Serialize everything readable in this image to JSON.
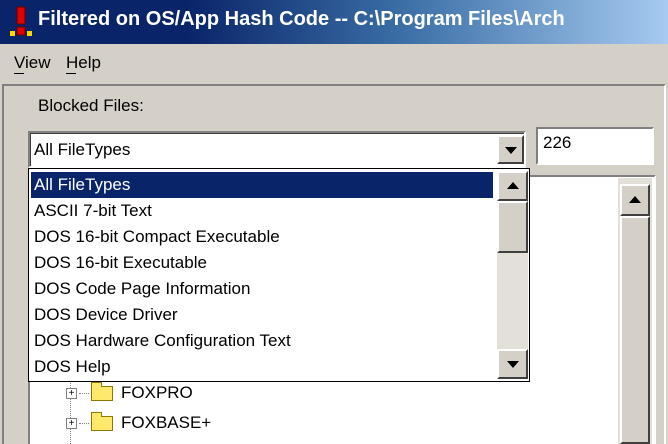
{
  "window": {
    "title": "Filtered on OS/App Hash Code -- C:\\Program Files\\Arch",
    "icon": "exclamation-app-icon"
  },
  "menu": {
    "view": "View",
    "help": "Help"
  },
  "blocked_files": {
    "label": "Blocked Files:",
    "filter_value": "All FileTypes",
    "count": "226"
  },
  "dropdown": {
    "items": [
      "All FileTypes",
      "ASCII 7-bit Text",
      "DOS 16-bit Compact Executable",
      "DOS 16-bit Executable",
      "DOS Code Page Information",
      "DOS Device Driver",
      "DOS Hardware Configuration Text",
      "DOS Help"
    ],
    "selected_index": 0
  },
  "tree": {
    "nodes": [
      "FOXPRO",
      "FOXBASE+"
    ]
  },
  "colors": {
    "selection": "#0a246a",
    "title_gradient_start": "#0a246a",
    "title_gradient_end": "#a6caf0",
    "face": "#d4d0c8"
  }
}
